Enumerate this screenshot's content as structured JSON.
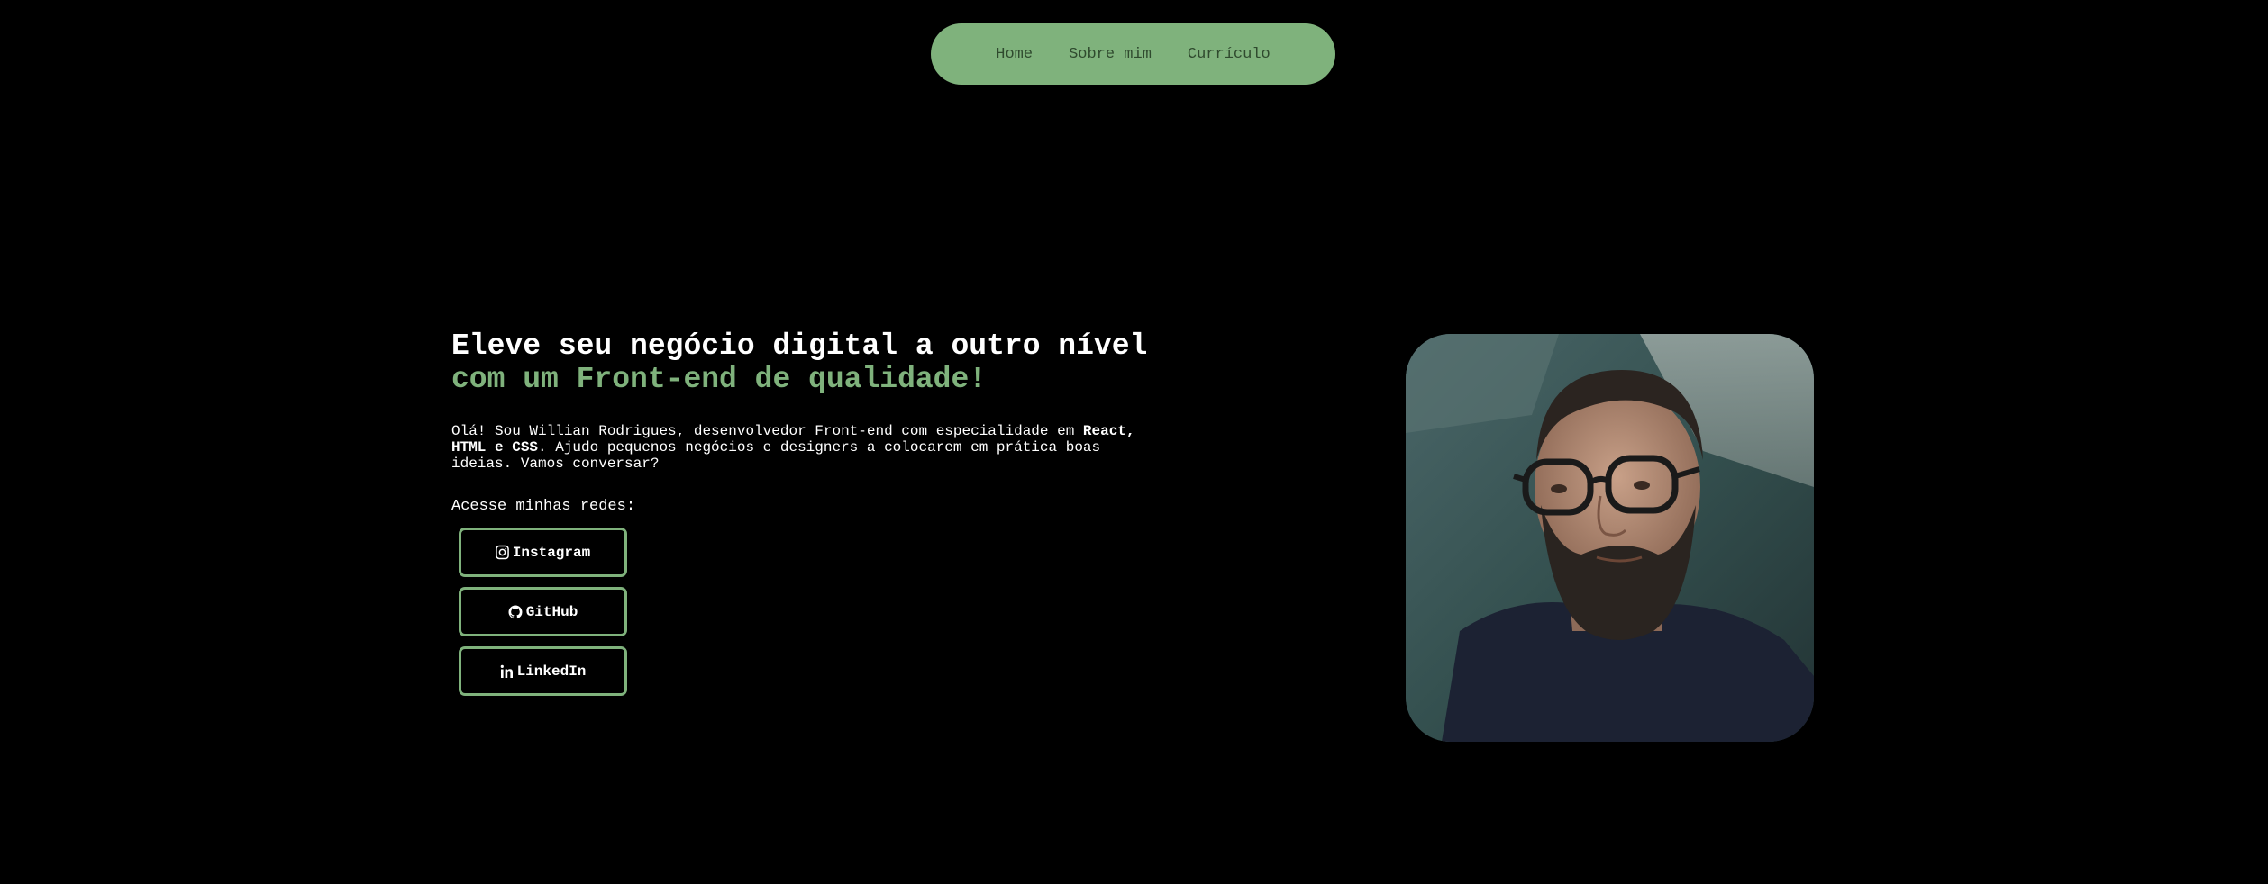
{
  "nav": {
    "items": [
      {
        "label": "Home"
      },
      {
        "label": "Sobre mim"
      },
      {
        "label": "Currículo"
      }
    ]
  },
  "hero": {
    "headline_line1": "Eleve seu negócio digital a outro nível",
    "headline_line2": "com um Front-end de qualidade!",
    "intro_part1": "Olá! Sou Willian Rodrigues, desenvolvedor Front-end com especialidade em ",
    "intro_bold": "React, HTML e CSS",
    "intro_part2": ". Ajudo pequenos negócios e designers a colocarem em prática boas ideias. Vamos conversar?",
    "social_label": "Acesse minhas redes:"
  },
  "social": [
    {
      "label": "Instagram",
      "icon": "instagram-icon"
    },
    {
      "label": "GitHub",
      "icon": "github-icon"
    },
    {
      "label": "LinkedIn",
      "icon": "linkedin-icon"
    }
  ],
  "colors": {
    "background": "#000000",
    "accent": "#7fb27c",
    "nav_text": "#2f4a2e",
    "text": "#ffffff"
  }
}
